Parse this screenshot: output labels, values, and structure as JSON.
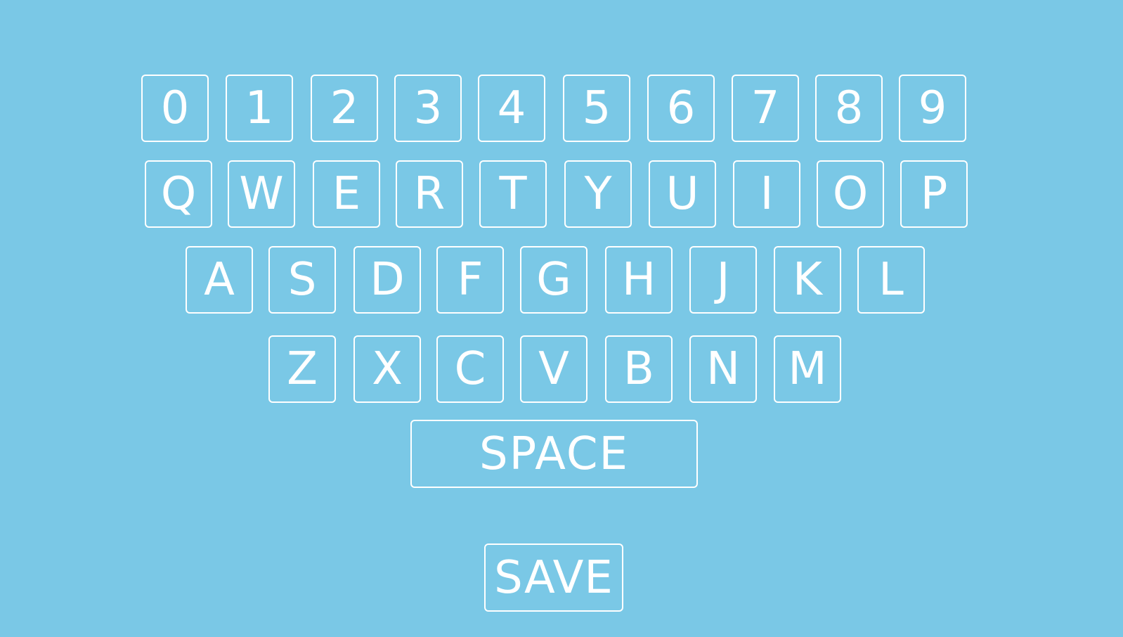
{
  "keyboard": {
    "digits": [
      "0",
      "1",
      "2",
      "3",
      "4",
      "5",
      "6",
      "7",
      "8",
      "9"
    ],
    "row_qwerty": [
      "Q",
      "W",
      "E",
      "R",
      "T",
      "Y",
      "U",
      "I",
      "O",
      "P"
    ],
    "row_asdf": [
      "A",
      "S",
      "D",
      "F",
      "G",
      "H",
      "J",
      "K",
      "L"
    ],
    "row_zxcv": [
      "Z",
      "X",
      "C",
      "V",
      "B",
      "N",
      "M"
    ],
    "space_label": "SPACE",
    "save_label": "SAVE"
  },
  "colors": {
    "background": "#7ac8e6",
    "key_border": "#ffffff",
    "key_text": "#ffffff"
  }
}
